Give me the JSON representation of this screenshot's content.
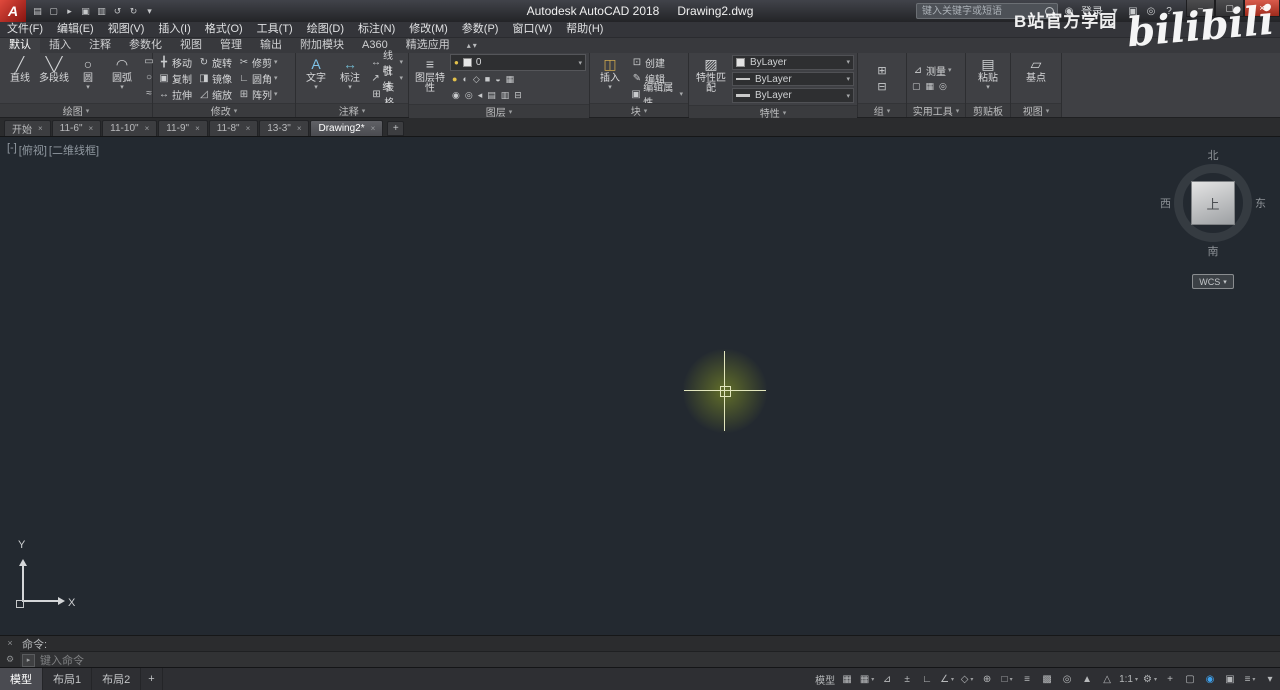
{
  "glyphs": {
    "caret": "▾",
    "caret_right": "▸",
    "close": "×",
    "minimize": "–",
    "maximize": "▢",
    "plus": "+",
    "collapse": "▴",
    "gear": "⚙"
  },
  "colors": {
    "close_button": "#c23b2e",
    "crosshair_glow": "#96a824",
    "statusbar_active_icon": "#3fa3ef",
    "drawing_background": "#232930",
    "app_logo_red": "#c02026"
  },
  "watermark": {
    "channel_name": "B站官方学园",
    "logo_text": "bilibili"
  },
  "titlebar": {
    "logo_letter": "A",
    "quick_access": [
      {
        "name": "qat-menu-icon",
        "glyph": "▤"
      },
      {
        "name": "new-file-icon",
        "glyph": "▢"
      },
      {
        "name": "open-file-icon",
        "glyph": "▸"
      },
      {
        "name": "save-icon",
        "glyph": "▣"
      },
      {
        "name": "plot-icon",
        "glyph": "▥"
      },
      {
        "name": "undo-icon",
        "glyph": "↺"
      },
      {
        "name": "redo-icon",
        "glyph": "↻"
      },
      {
        "name": "qat-dropdown-icon",
        "glyph": "▾"
      }
    ],
    "app_title": "Autodesk AutoCAD 2018",
    "doc_title": "Drawing2.dwg",
    "search_placeholder": "键入关键字或短语",
    "right_items": [
      {
        "name": "signin-user-icon",
        "glyph": "◉"
      },
      {
        "name": "signin-label",
        "label": "登录"
      },
      {
        "name": "signin-caret-icon",
        "glyph": "▾"
      },
      {
        "name": "exchange-apps-icon",
        "glyph": "▣"
      },
      {
        "name": "stay-connected-icon",
        "glyph": "◎"
      },
      {
        "name": "help-icon",
        "glyph": "?"
      }
    ]
  },
  "menubar": [
    "文件(F)",
    "编辑(E)",
    "视图(V)",
    "插入(I)",
    "格式(O)",
    "工具(T)",
    "绘图(D)",
    "标注(N)",
    "修改(M)",
    "参数(P)",
    "窗口(W)",
    "帮助(H)"
  ],
  "ribbon": {
    "tabs": [
      "默认",
      "插入",
      "注释",
      "参数化",
      "视图",
      "管理",
      "输出",
      "附加模块",
      "A360",
      "精选应用"
    ],
    "active_tab": "默认",
    "draw_panel": {
      "label": "绘图",
      "big": [
        {
          "name": "line-button",
          "label": "直线",
          "glyph": "╱"
        },
        {
          "name": "polyline-button",
          "label": "多段线",
          "glyph": "╲╱"
        },
        {
          "name": "circle-button",
          "label": "圆",
          "glyph": "○",
          "caret": true
        },
        {
          "name": "arc-button",
          "label": "圆弧",
          "glyph": "◠",
          "caret": true
        }
      ],
      "small": [
        {
          "name": "rectangle-icon",
          "glyph": "▭"
        },
        {
          "name": "hatch-icon",
          "glyph": "▨"
        },
        {
          "name": "ellipse-icon",
          "glyph": "○"
        },
        {
          "name": "polygon-icon",
          "glyph": "◇"
        },
        {
          "name": "spline-icon",
          "glyph": "≈"
        },
        {
          "name": "point-icon",
          "glyph": "+"
        }
      ]
    },
    "modify_panel": {
      "label": "修改",
      "buttons": [
        {
          "name": "move-button",
          "label": "移动",
          "glyph": "╋"
        },
        {
          "name": "rotate-button",
          "label": "旋转",
          "glyph": "↻"
        },
        {
          "name": "trim-button",
          "label": "修剪",
          "glyph": "✂",
          "caret": true
        },
        {
          "name": "copy-button",
          "label": "复制",
          "glyph": "▣"
        },
        {
          "name": "mirror-button",
          "label": "镜像",
          "glyph": "◨"
        },
        {
          "name": "fillet-button",
          "label": "圆角",
          "glyph": "∟",
          "caret": true
        },
        {
          "name": "stretch-button",
          "label": "拉伸",
          "glyph": "↔"
        },
        {
          "name": "scale-button",
          "label": "缩放",
          "glyph": "◿"
        },
        {
          "name": "array-button",
          "label": "阵列",
          "glyph": "⊞",
          "caret": true
        }
      ]
    },
    "annotate_panel": {
      "label": "注释",
      "big": [
        {
          "name": "text-button",
          "label": "文字",
          "glyph": "A",
          "caret": true,
          "tint": "#7ec3e8"
        },
        {
          "name": "dimension-button",
          "label": "标注",
          "glyph": "↔",
          "caret": true,
          "tint": "#6fb3c9"
        }
      ],
      "small": [
        {
          "name": "linear-dim-button",
          "label": "线性",
          "glyph": "↔",
          "caret": true
        },
        {
          "name": "leader-button",
          "label": "引线",
          "glyph": "↗",
          "caret": true
        },
        {
          "name": "table-button",
          "label": "表格",
          "glyph": "⊞"
        }
      ]
    },
    "layers_panel": {
      "label": "图层",
      "properties_button": {
        "name": "layer-properties-button",
        "label": "图层特性",
        "glyph": "≡"
      },
      "current_layer": "0",
      "tools_row1": [
        {
          "name": "layer-off-icon",
          "glyph": "●",
          "tint": "#e3c14b"
        },
        {
          "name": "layer-isolate-icon",
          "glyph": "◐"
        },
        {
          "name": "layer-freeze-icon",
          "glyph": "◇"
        },
        {
          "name": "layer-lock-icon",
          "glyph": "■"
        },
        {
          "name": "layer-on-icon",
          "glyph": "◒"
        },
        {
          "name": "layer-settings-icon",
          "glyph": "▦"
        }
      ],
      "tools_row2": [
        {
          "name": "make-current-icon",
          "glyph": "◉"
        },
        {
          "name": "match-layer-icon",
          "glyph": "◎"
        },
        {
          "name": "prev-layer-icon",
          "glyph": "◂"
        },
        {
          "name": "layer-walk-icon",
          "glyph": "▤"
        },
        {
          "name": "layer-thaw-icon",
          "glyph": "▥"
        },
        {
          "name": "layer-unlock-icon",
          "glyph": "⊟"
        }
      ]
    },
    "block_panel": {
      "label": "块",
      "insert": {
        "name": "insert-block-button",
        "label": "插入",
        "glyph": "◫",
        "caret": true,
        "tint": "#cfa84f"
      },
      "small": [
        {
          "name": "create-block-button",
          "label": "创建",
          "glyph": "⊡"
        },
        {
          "name": "edit-block-button",
          "label": "编辑",
          "glyph": "✎"
        },
        {
          "name": "edit-attributes-button",
          "label": "编辑属性",
          "glyph": "▣",
          "caret": true
        }
      ]
    },
    "properties_panel": {
      "label": "特性",
      "match_button": {
        "name": "match-properties-button",
        "label": "特性匹配",
        "glyph": "▨"
      },
      "rows": [
        {
          "name": "object-color-select",
          "value": "ByLayer",
          "swatch": "color"
        },
        {
          "name": "linetype-select",
          "value": "ByLayer",
          "swatch": "line"
        },
        {
          "name": "lineweight-select",
          "value": "ByLayer",
          "swatch": "lineweight"
        }
      ]
    },
    "group_panel": {
      "label": "组",
      "buttons": [
        {
          "name": "group-button",
          "glyph": "⊞"
        },
        {
          "name": "ungroup-button",
          "glyph": "⊟"
        }
      ]
    },
    "utilities_panel": {
      "label": "实用工具",
      "measure": {
        "name": "measure-button",
        "label": "测量",
        "glyph": "⊿",
        "caret": true
      },
      "small": [
        {
          "name": "quick-select-icon",
          "glyph": "▢"
        },
        {
          "name": "quick-calc-icon",
          "glyph": "▦"
        },
        {
          "name": "id-point-icon",
          "glyph": "◎"
        }
      ]
    },
    "clipboard_panel": {
      "label": "剪贴板",
      "paste": {
        "name": "paste-button",
        "label": "粘贴",
        "glyph": "▤",
        "caret": true
      }
    },
    "view_panel": {
      "label": "视图",
      "base": {
        "name": "base-button",
        "label": "基点",
        "glyph": "▱"
      }
    }
  },
  "file_tabs": {
    "tabs": [
      "开始",
      "11-6\"",
      "11-10\"",
      "11-9\"",
      "11-8\"",
      "13-3\"",
      "Drawing2*"
    ],
    "active_index": 6
  },
  "viewport": {
    "controls": [
      "[-]",
      "[俯视]",
      "[二维线框]"
    ]
  },
  "viewcube": {
    "north": "北",
    "south": "南",
    "west": "西",
    "east": "东",
    "top": "上",
    "wcs": "WCS"
  },
  "ucs_icon": {
    "x_label": "X",
    "y_label": "Y"
  },
  "command_line": {
    "prompt": "命令:",
    "input_placeholder": "键入命令"
  },
  "layout_tabs": {
    "tabs": [
      "模型",
      "布局1",
      "布局2"
    ],
    "active_index": 0
  },
  "statusbar": {
    "items": [
      {
        "name": "model-space-button",
        "label": "模型"
      },
      {
        "name": "grid-icon",
        "glyph": "▦"
      },
      {
        "name": "snap-icon",
        "glyph": "▦",
        "caret": true
      },
      {
        "name": "infer-constraints-icon",
        "glyph": "⊿"
      },
      {
        "name": "dynamic-input-icon",
        "glyph": "±"
      },
      {
        "name": "ortho-icon",
        "glyph": "∟"
      },
      {
        "name": "polar-tracking-icon",
        "glyph": "∠",
        "caret": true
      },
      {
        "name": "isometric-drafting-icon",
        "glyph": "◇",
        "caret": true
      },
      {
        "name": "object-snap-tracking-icon",
        "glyph": "⊕"
      },
      {
        "name": "object-snap-icon",
        "glyph": "□",
        "caret": true
      },
      {
        "name": "lineweight-icon",
        "glyph": "≡"
      },
      {
        "name": "transparency-icon",
        "glyph": "▩"
      },
      {
        "name": "selection-cycling-icon",
        "glyph": "◎"
      },
      {
        "name": "annotation-visibility-icon",
        "glyph": "▲"
      },
      {
        "name": "annotation-autoscale-icon",
        "glyph": "△"
      },
      {
        "name": "annotation-scale-button",
        "label": "1:1",
        "caret": true
      },
      {
        "name": "workspace-switching-icon",
        "glyph": "⚙",
        "caret": true
      },
      {
        "name": "annotation-monitor-icon",
        "glyph": "+"
      },
      {
        "name": "quick-properties-icon",
        "glyph": "▢"
      },
      {
        "name": "graphics-performance-icon",
        "glyph": "◉",
        "blue": true
      },
      {
        "name": "clean-screen-icon",
        "glyph": "▣"
      },
      {
        "name": "customization-icon",
        "glyph": "≡",
        "caret": true
      },
      {
        "name": "status-collapse-icon",
        "glyph": "▾"
      }
    ]
  }
}
